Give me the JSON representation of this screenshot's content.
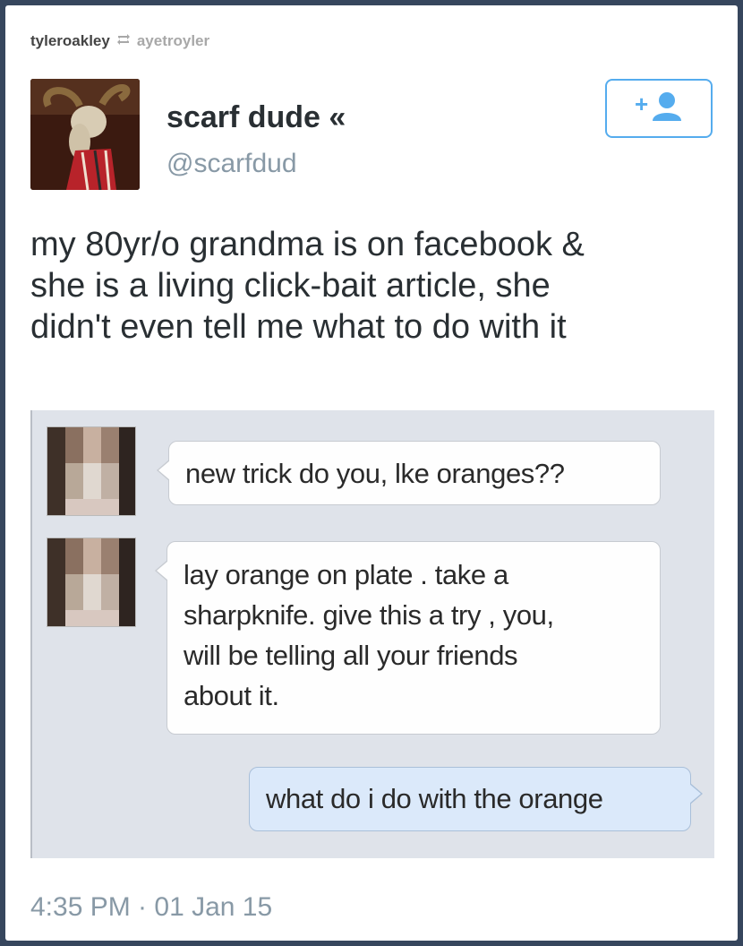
{
  "reblog": {
    "user": "tyleroakley",
    "icon": "reblog-icon",
    "source": "ayetroyler"
  },
  "tweet": {
    "display_name": "scarf dude «",
    "handle": "@scarfdud",
    "follow_icon": "follow-user-icon",
    "follow_label": "+",
    "text_lines": [
      "my 80yr/o grandma is on facebook &",
      "she is a living click-bait article, she",
      "didn't even tell me what to do with it"
    ],
    "timestamp": "4:35 PM · 01 Jan 15"
  },
  "chat": {
    "messages": [
      {
        "lines": [
          "new trick do you, lke oranges??"
        ]
      },
      {
        "lines": [
          "lay orange on plate . take a",
          "sharpknife. give this a try , you,",
          "will be telling all your friends",
          "about it."
        ]
      },
      {
        "lines": [
          "what do i do with the orange"
        ]
      }
    ]
  },
  "colors": {
    "accent": "#55acee",
    "chat_bg": "#dfe3ea",
    "outgoing_bubble": "#dbe9fa"
  }
}
